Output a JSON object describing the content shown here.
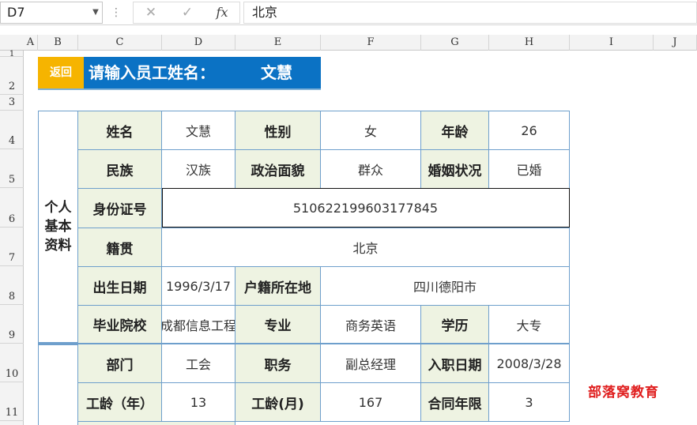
{
  "formula_bar": {
    "name_box": "D7",
    "cancel_icon": "✕",
    "enter_icon": "✓",
    "fx_label": "fx",
    "formula": "北京"
  },
  "columns": [
    "A",
    "B",
    "C",
    "D",
    "E",
    "F",
    "G",
    "H",
    "I",
    "J"
  ],
  "rows": [
    "1",
    "2",
    "3",
    "4",
    "5",
    "6",
    "7",
    "8",
    "9",
    "10",
    "11"
  ],
  "banner": {
    "back_button": "返回",
    "prompt": "请输入员工姓名：",
    "name": "文慧"
  },
  "sections": {
    "personal_l1": "个人",
    "personal_l2": "基本",
    "personal_l3": "资料"
  },
  "form": {
    "name_label": "姓名",
    "name": "文慧",
    "gender_label": "性别",
    "gender": "女",
    "age_label": "年龄",
    "age": "26",
    "ethnic_label": "民族",
    "ethnic": "汉族",
    "political_label": "政治面貌",
    "political": "群众",
    "marital_label": "婚姻状况",
    "marital": "已婚",
    "id_label": "身份证号",
    "id": "510622199603177845",
    "native_label": "籍贯",
    "native": "北京",
    "birth_label": "出生日期",
    "birth": "1996/3/17",
    "household_label": "户籍所在地",
    "household": "四川德阳市",
    "school_label": "毕业院校",
    "school": "成都信息工程",
    "major_label": "专业",
    "major": "商务英语",
    "edu_label": "学历",
    "edu": "大专",
    "dept_label": "部门",
    "dept": "工会",
    "position_label": "职务",
    "position": "副总经理",
    "hire_label": "入职日期",
    "hire": "2008/3/28",
    "years_label": "工龄（年）",
    "years": "13",
    "months_label": "工龄(月)",
    "months": "167",
    "contract_label": "合同年限",
    "contract": "3"
  },
  "watermark": "部落窝教育",
  "colors": {
    "banner_blue": "#0b72c4",
    "back_yellow": "#f6b400",
    "label_bg": "#eef3e2",
    "border": "#6e9fcc",
    "watermark": "#e02020"
  }
}
